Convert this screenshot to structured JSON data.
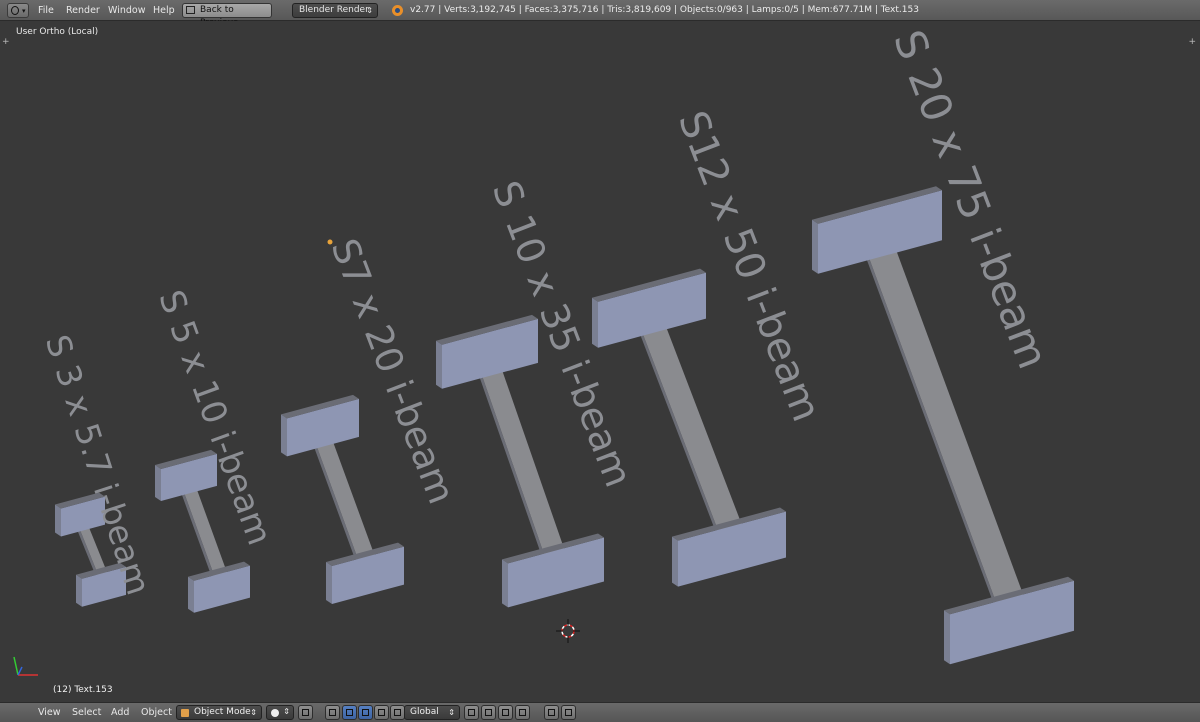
{
  "topbar": {
    "editor_icon": "info-editor-icon",
    "menus": [
      "File",
      "Render",
      "Window",
      "Help"
    ],
    "back_button": "Back to Previous",
    "render_engine": "Blender Render",
    "stats": "v2.77 | Verts:3,192,745 | Faces:3,375,716 | Tris:3,819,609 | Objects:0/963 | Lamps:0/5 | Mem:677.71M | Text.153"
  },
  "viewport": {
    "view_label": "User Ortho (Local)",
    "object_label": "(12) Text.153",
    "beam_labels": [
      "S 3 x 5.7 i-beam",
      "S 5 x 10 i-beam",
      "S7 x 20 i-beam",
      "S 10 x 35 i-beam",
      "S12 x 50 i-beam",
      "S 20 x 75 i-beam"
    ],
    "colors": {
      "background": "#393939",
      "beam_face": "#8e96b3",
      "beam_dark": "#6a6c75",
      "label": "#8c8e93"
    }
  },
  "bottombar": {
    "menus": [
      "View",
      "Select",
      "Add",
      "Object"
    ],
    "mode": "Object Mode",
    "transform_orientation": "Global"
  }
}
